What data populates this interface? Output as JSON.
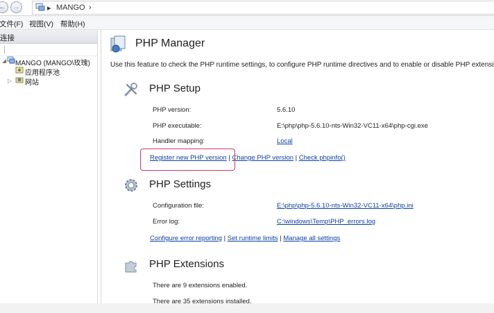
{
  "address": {
    "crumb": "MANGO",
    "arrow1": "▸",
    "arrow2": "›"
  },
  "menu": {
    "file": "文件(F)",
    "view": "视图(V)",
    "help": "帮助(H)"
  },
  "left_pane": {
    "header": "连接",
    "tree": {
      "server": "MANGO (MANGO\\玫瑰)",
      "app_pools": "应用程序池",
      "sites": "网站"
    }
  },
  "main": {
    "title": "PHP Manager",
    "description": "Use this feature to check the PHP runtime settings, to configure PHP runtime directives and to enable or disable PHP extensions.",
    "setup": {
      "title": "PHP Setup",
      "version_label": "PHP version:",
      "version_value": "5.6.10",
      "exe_label": "PHP executable:",
      "exe_value": "E:\\php\\php-5.6.10-nts-Win32-VC11-x64\\php-cgi.exe",
      "handler_label": "Handler mapping:",
      "handler_value": "Local",
      "link_register": "Register new PHP version",
      "link_change": "Change PHP version",
      "link_check": "Check phpinfo()",
      "sep": "|"
    },
    "settings": {
      "title": "PHP Settings",
      "config_label": "Configuration file:",
      "config_value": "E:\\php\\php-5.6.10-nts-Win32-VC11-x64\\php.ini",
      "errlog_label": "Error log:",
      "errlog_value": "C:\\windows\\Temp\\PHP_errors.log",
      "link_error": "Configure error reporting",
      "link_runtime": "Set runtime limits",
      "link_manage": "Manage all settings",
      "sep": "|"
    },
    "extensions": {
      "title": "PHP Extensions",
      "enabled": "There are 9 extensions enabled.",
      "installed": "There are 35 extensions installed."
    }
  },
  "colors": {
    "link": "#0b3fa5",
    "highlight": "#d4336f"
  }
}
